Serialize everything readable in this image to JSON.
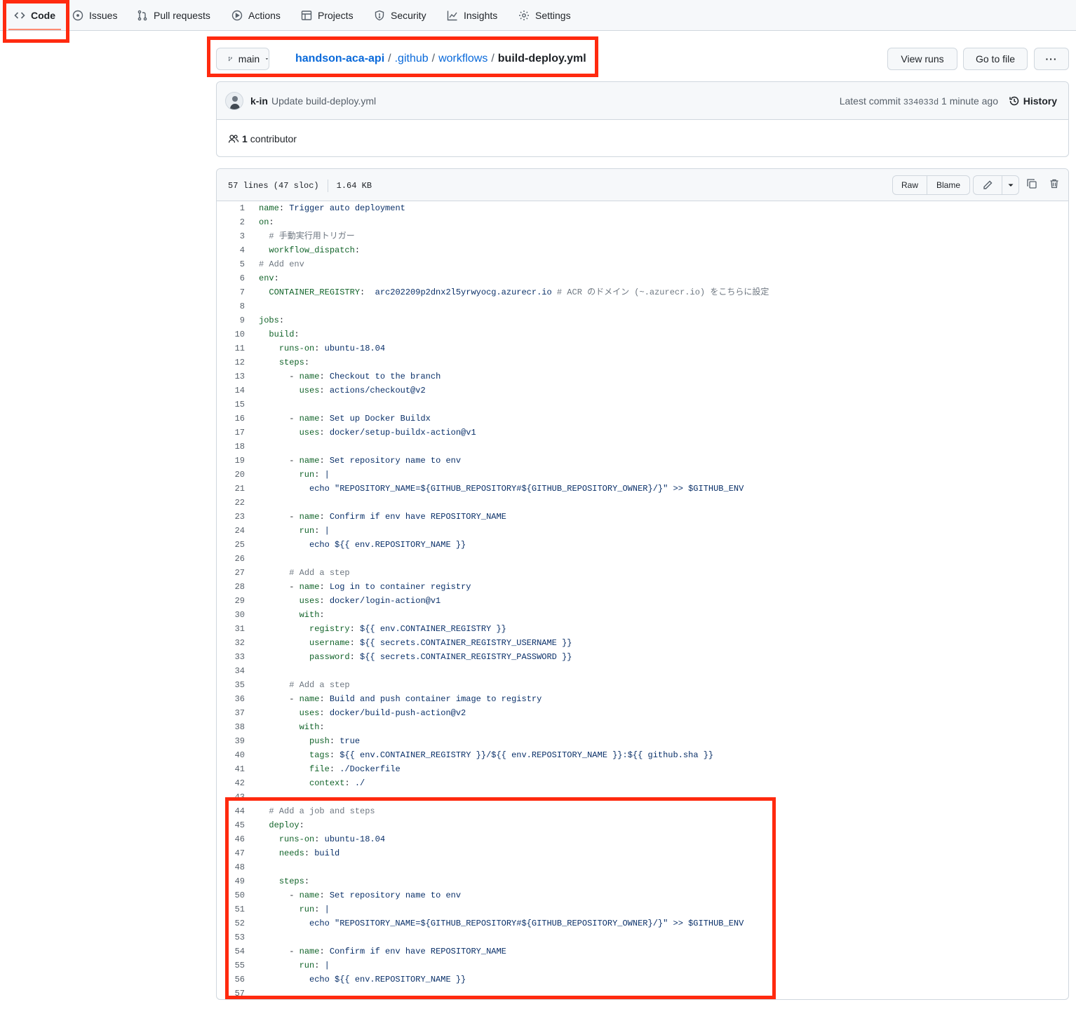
{
  "nav": {
    "tabs": [
      {
        "label": "Code",
        "icon": "code-icon",
        "active": true
      },
      {
        "label": "Issues",
        "icon": "issue-opened-icon"
      },
      {
        "label": "Pull requests",
        "icon": "git-pull-request-icon"
      },
      {
        "label": "Actions",
        "icon": "play-icon"
      },
      {
        "label": "Projects",
        "icon": "table-icon"
      },
      {
        "label": "Security",
        "icon": "shield-icon"
      },
      {
        "label": "Insights",
        "icon": "graph-icon"
      },
      {
        "label": "Settings",
        "icon": "gear-icon"
      }
    ]
  },
  "breadcrumb": {
    "branch": "main",
    "repo": "handson-aca-api",
    "dir1": ".github",
    "dir2": "workflows",
    "file": "build-deploy.yml",
    "sep": "/"
  },
  "actions": {
    "view_runs": "View runs",
    "go_to_file": "Go to file",
    "more": "···"
  },
  "commit": {
    "author": "k-in",
    "message": "Update build-deploy.yml",
    "latest_label": "Latest commit",
    "sha": "334033d",
    "time": "1 minute ago",
    "history_label": "History",
    "contributors": "1",
    "contributors_label": "contributor"
  },
  "file": {
    "lines_info": "57 lines (47 sloc)",
    "size": "1.64 KB",
    "raw_label": "Raw",
    "blame_label": "Blame"
  },
  "colors": {
    "annotation": "#ff2a0f",
    "link": "#0969da",
    "yaml_key": "#116329",
    "yaml_value": "#0a3069",
    "comment": "#6e7781"
  },
  "code_lines": [
    "name: Trigger auto deployment",
    "on:",
    "  # 手動実行用トリガー",
    "  workflow_dispatch:",
    "# Add env",
    "env:",
    "  CONTAINER_REGISTRY:  arc202209p2dnx2l5yrwyocg.azurecr.io # ACR のドメイン (~.azurecr.io) をこちらに設定",
    "",
    "jobs:",
    "  build:",
    "    runs-on: ubuntu-18.04",
    "    steps:",
    "      - name: Checkout to the branch",
    "        uses: actions/checkout@v2",
    "",
    "      - name: Set up Docker Buildx",
    "        uses: docker/setup-buildx-action@v1",
    "",
    "      - name: Set repository name to env",
    "        run: |",
    "          echo \"REPOSITORY_NAME=${GITHUB_REPOSITORY#${GITHUB_REPOSITORY_OWNER}/}\" >> $GITHUB_ENV",
    "",
    "      - name: Confirm if env have REPOSITORY_NAME",
    "        run: |",
    "          echo ${{ env.REPOSITORY_NAME }}",
    "",
    "      # Add a step",
    "      - name: Log in to container registry",
    "        uses: docker/login-action@v1",
    "        with:",
    "          registry: ${{ env.CONTAINER_REGISTRY }}",
    "          username: ${{ secrets.CONTAINER_REGISTRY_USERNAME }}",
    "          password: ${{ secrets.CONTAINER_REGISTRY_PASSWORD }}",
    "",
    "      # Add a step",
    "      - name: Build and push container image to registry",
    "        uses: docker/build-push-action@v2",
    "        with:",
    "          push: true",
    "          tags: ${{ env.CONTAINER_REGISTRY }}/${{ env.REPOSITORY_NAME }}:${{ github.sha }}",
    "          file: ./Dockerfile",
    "          context: ./",
    "",
    "  # Add a job and steps",
    "  deploy:",
    "    runs-on: ubuntu-18.04",
    "    needs: build",
    "",
    "    steps:",
    "      - name: Set repository name to env",
    "        run: |",
    "          echo \"REPOSITORY_NAME=${GITHUB_REPOSITORY#${GITHUB_REPOSITORY_OWNER}/}\" >> $GITHUB_ENV",
    "",
    "      - name: Confirm if env have REPOSITORY_NAME",
    "        run: |",
    "          echo ${{ env.REPOSITORY_NAME }}",
    ""
  ]
}
